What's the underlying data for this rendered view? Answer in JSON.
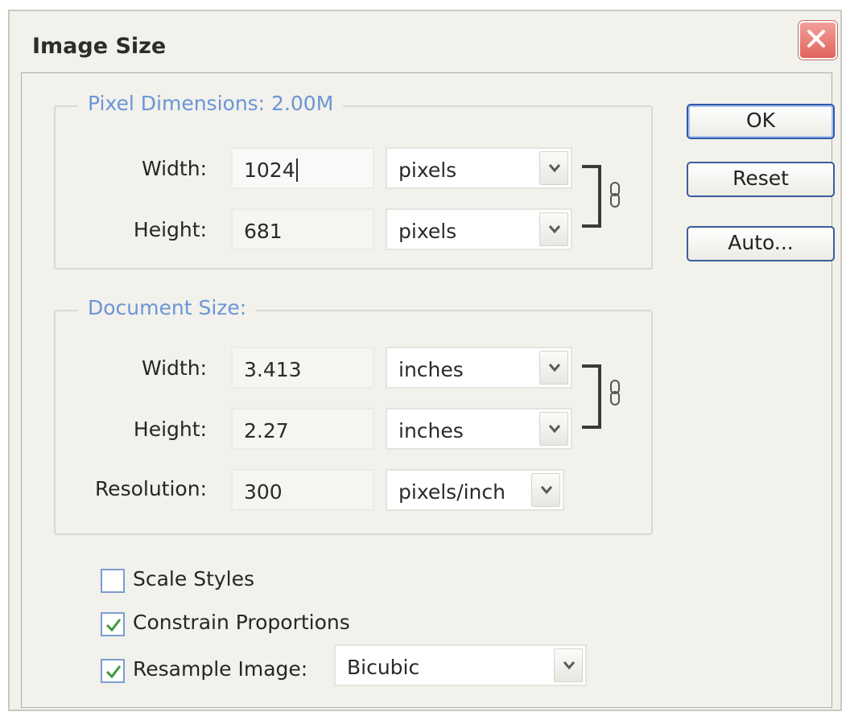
{
  "window": {
    "title": "Image Size"
  },
  "pixel_dimensions": {
    "legend": "Pixel Dimensions:  2.00M",
    "width": {
      "label": "Width:",
      "value": "1024",
      "unit": "pixels"
    },
    "height": {
      "label": "Height:",
      "value": "681",
      "unit": "pixels"
    }
  },
  "document_size": {
    "legend": "Document Size:",
    "width": {
      "label": "Width:",
      "value": "3.413",
      "unit": "inches"
    },
    "height": {
      "label": "Height:",
      "value": "2.27",
      "unit": "inches"
    },
    "resolution": {
      "label": "Resolution:",
      "value": "300",
      "unit": "pixels/inch"
    }
  },
  "buttons": {
    "ok": "OK",
    "reset": "Reset",
    "auto": "Auto..."
  },
  "options": {
    "scale_styles": {
      "label": "Scale Styles",
      "checked": false
    },
    "constrain_proportions": {
      "label": "Constrain Proportions",
      "checked": true
    },
    "resample_image": {
      "label": "Resample Image:",
      "checked": true,
      "method": "Bicubic"
    }
  },
  "colors": {
    "legend_text": "#6b95d6",
    "check_mark": "#3c9a3c",
    "close_button": "#e0645c",
    "button_border": "#3a5d9c"
  },
  "icons": [
    "close-icon",
    "chevron-down-icon",
    "chain-link-icon",
    "checkmark-icon"
  ]
}
